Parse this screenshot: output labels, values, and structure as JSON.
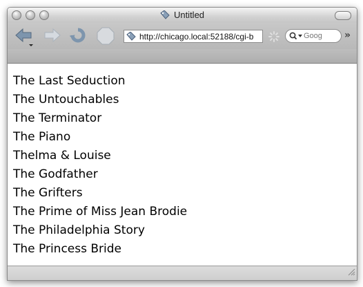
{
  "window": {
    "title": "Untitled"
  },
  "toolbar": {
    "back_icon": "back-arrow-icon",
    "forward_icon": "forward-arrow-icon",
    "reload_icon": "reload-icon",
    "stop_icon": "stop-icon",
    "url": "http://chicago.local:52188/cgi-b",
    "search_placeholder": "Goog"
  },
  "content": {
    "movies": [
      "The Last Seduction",
      "The Untouchables",
      "The Terminator",
      "The Piano",
      "Thelma & Louise",
      "The Godfather",
      "The Grifters",
      "The Prime of Miss Jean Brodie",
      "The Philadelphia Story",
      "The Princess Bride"
    ]
  }
}
